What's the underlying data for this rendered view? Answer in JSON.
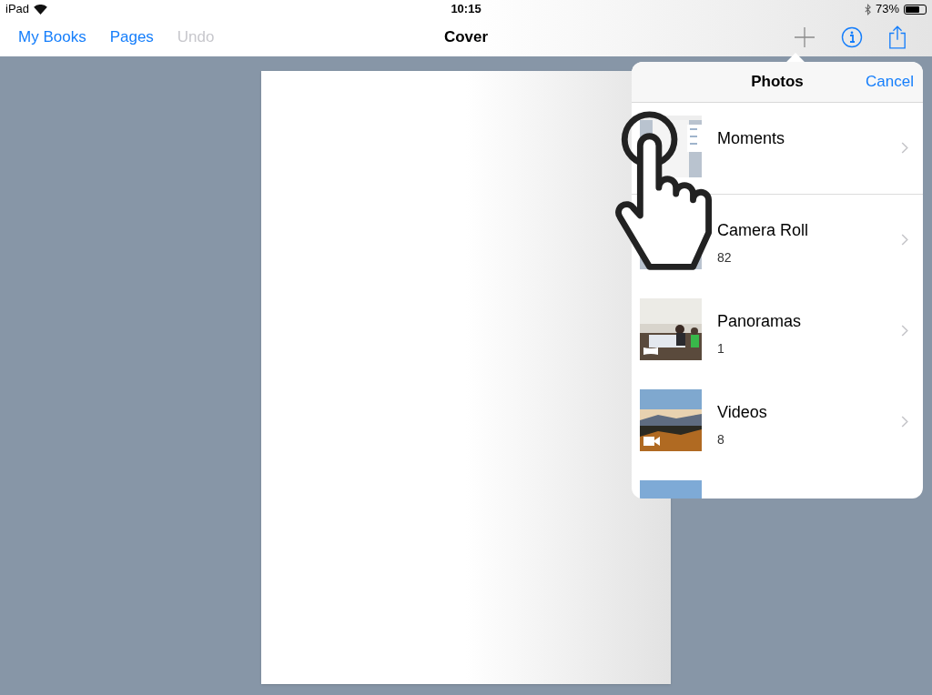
{
  "status_bar": {
    "carrier": "iPad",
    "time": "10:15",
    "battery": "73%"
  },
  "nav_bar": {
    "buttons": [
      {
        "label": "My Books",
        "disabled": false
      },
      {
        "label": "Pages",
        "disabled": false
      },
      {
        "label": "Undo",
        "disabled": true
      }
    ],
    "title": "Cover"
  },
  "popover": {
    "title": "Photos",
    "cancel": "Cancel",
    "sections": [
      {
        "albums": [
          {
            "kind": "screenshot",
            "name": "Moments"
          }
        ]
      },
      {
        "albums": [
          {
            "kind": "screenshot",
            "name": "Camera Roll",
            "count": "82"
          },
          {
            "kind": "panorama",
            "name": "Panoramas",
            "count": "1"
          },
          {
            "kind": "video",
            "name": "Videos",
            "count": "8"
          },
          {
            "kind": "sky"
          }
        ]
      }
    ]
  }
}
